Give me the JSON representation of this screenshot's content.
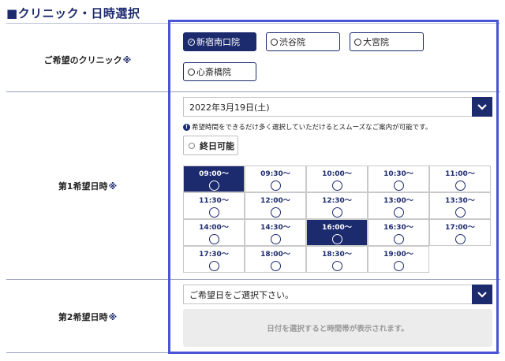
{
  "section": {
    "title": "■クリニック・日時選択"
  },
  "clinic": {
    "label": "ご希望のクリニック",
    "required_mark": "※",
    "options": [
      {
        "label": "新宿南口院",
        "selected": true
      },
      {
        "label": "渋谷院",
        "selected": false
      },
      {
        "label": "大宮院",
        "selected": false
      },
      {
        "label": "心斎橋院",
        "selected": false
      }
    ]
  },
  "first_choice": {
    "label": "第1希望日時",
    "required_mark": "※",
    "date_value": "2022年3月19日(土)",
    "notice": "希望時間をできるだけ多く選択していただけるとスムーズなご案内が可能です。",
    "allday_label": "終日可能",
    "time_slots": [
      {
        "time": "09:00〜",
        "selected": true
      },
      {
        "time": "09:30〜",
        "selected": false
      },
      {
        "time": "10:00〜",
        "selected": false
      },
      {
        "time": "10:30〜",
        "selected": false
      },
      {
        "time": "11:00〜",
        "selected": false
      },
      {
        "time": "11:30〜",
        "selected": false
      },
      {
        "time": "12:00〜",
        "selected": false
      },
      {
        "time": "12:30〜",
        "selected": false
      },
      {
        "time": "13:00〜",
        "selected": false
      },
      {
        "time": "13:30〜",
        "selected": false
      },
      {
        "time": "14:00〜",
        "selected": false
      },
      {
        "time": "14:30〜",
        "selected": false
      },
      {
        "time": "16:00〜",
        "selected": true
      },
      {
        "time": "16:30〜",
        "selected": false
      },
      {
        "time": "17:00〜",
        "selected": false
      },
      {
        "time": "17:30〜",
        "selected": false
      },
      {
        "time": "18:00〜",
        "selected": false
      },
      {
        "time": "18:30〜",
        "selected": false
      },
      {
        "time": "19:00〜",
        "selected": false
      }
    ]
  },
  "second_choice": {
    "label": "第2希望日時",
    "required_mark": "※",
    "date_placeholder": "ご希望日をご選択下さい。",
    "disabled_message": "日付を選択すると時間帯が表示されます。"
  },
  "colors": {
    "accent": "#1c2a6e",
    "highlight": "#4a54d6"
  },
  "icons": {
    "select_arrow": "chevron-down-icon",
    "info": "info-icon"
  }
}
